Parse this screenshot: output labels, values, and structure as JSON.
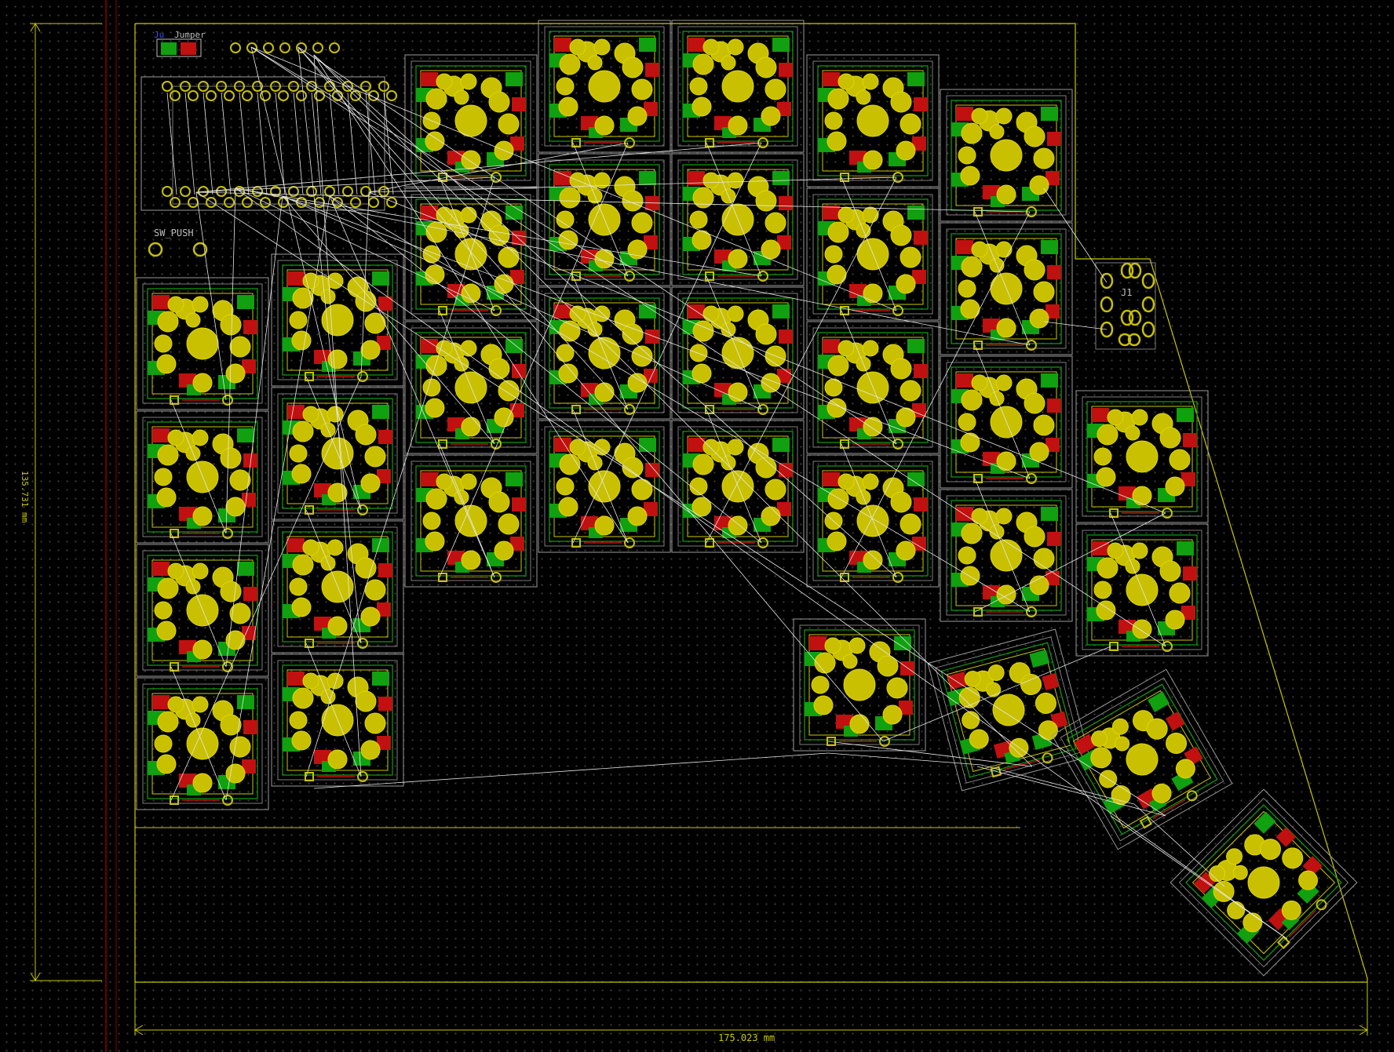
{
  "board": {
    "jumper_label": "Jumper",
    "jumper_ref": "Ju",
    "push_label": "SW_PUSH",
    "connector_label": "J1",
    "height_dim": "135.731 mm",
    "width_dim": "175.023 mm"
  },
  "colors": {
    "background": "#000000",
    "grid_dot": "#3c3c3c",
    "edge": "#c8c800",
    "pad": "#c8c000",
    "pad_stroke": "#e0d800",
    "front_copper": "#c01010",
    "back_copper": "#10a010",
    "courtyard": "#9a9a9a",
    "ratsnest": "#e8e8e8",
    "silkscreen": "#bcbcbc",
    "margin_line": "#8b0000"
  },
  "icons": {
    "switch_footprint": "keyswitch-footprint-icon",
    "pad": "pad-icon",
    "mcu": "mcu-footprint-icon"
  }
}
